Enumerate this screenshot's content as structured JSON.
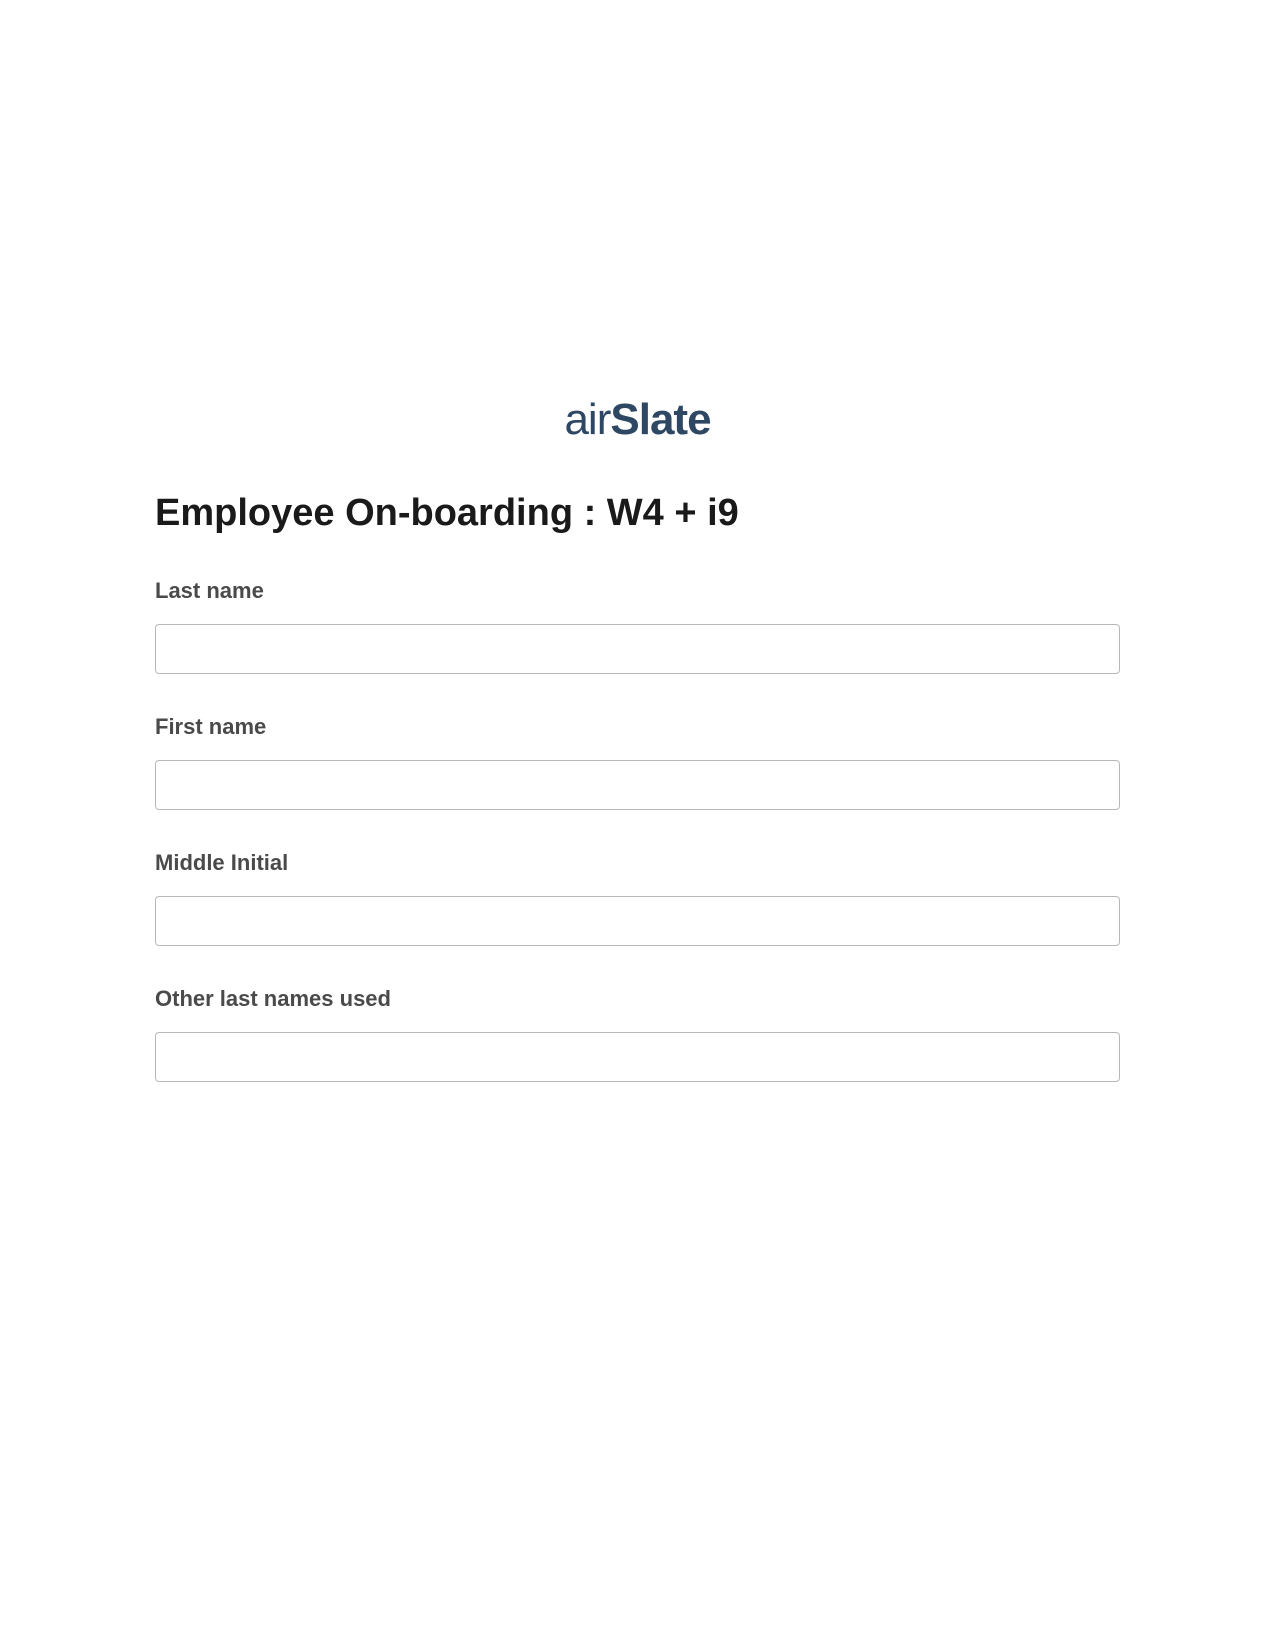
{
  "logo": {
    "part1": "air",
    "part2": "Slate"
  },
  "title": "Employee On-boarding : W4 + i9",
  "fields": [
    {
      "label": "Last name",
      "value": ""
    },
    {
      "label": "First name",
      "value": ""
    },
    {
      "label": "Middle Initial",
      "value": ""
    },
    {
      "label": "Other last names used",
      "value": ""
    }
  ]
}
